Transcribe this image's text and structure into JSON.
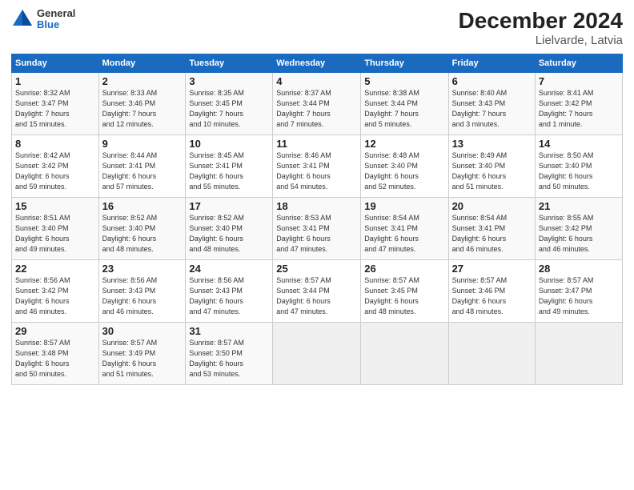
{
  "header": {
    "logo_general": "General",
    "logo_blue": "Blue",
    "title": "December 2024",
    "subtitle": "Lielvarde, Latvia"
  },
  "weekdays": [
    "Sunday",
    "Monday",
    "Tuesday",
    "Wednesday",
    "Thursday",
    "Friday",
    "Saturday"
  ],
  "weeks": [
    [
      {
        "day": "1",
        "info": "Sunrise: 8:32 AM\nSunset: 3:47 PM\nDaylight: 7 hours\nand 15 minutes."
      },
      {
        "day": "2",
        "info": "Sunrise: 8:33 AM\nSunset: 3:46 PM\nDaylight: 7 hours\nand 12 minutes."
      },
      {
        "day": "3",
        "info": "Sunrise: 8:35 AM\nSunset: 3:45 PM\nDaylight: 7 hours\nand 10 minutes."
      },
      {
        "day": "4",
        "info": "Sunrise: 8:37 AM\nSunset: 3:44 PM\nDaylight: 7 hours\nand 7 minutes."
      },
      {
        "day": "5",
        "info": "Sunrise: 8:38 AM\nSunset: 3:44 PM\nDaylight: 7 hours\nand 5 minutes."
      },
      {
        "day": "6",
        "info": "Sunrise: 8:40 AM\nSunset: 3:43 PM\nDaylight: 7 hours\nand 3 minutes."
      },
      {
        "day": "7",
        "info": "Sunrise: 8:41 AM\nSunset: 3:42 PM\nDaylight: 7 hours\nand 1 minute."
      }
    ],
    [
      {
        "day": "8",
        "info": "Sunrise: 8:42 AM\nSunset: 3:42 PM\nDaylight: 6 hours\nand 59 minutes."
      },
      {
        "day": "9",
        "info": "Sunrise: 8:44 AM\nSunset: 3:41 PM\nDaylight: 6 hours\nand 57 minutes."
      },
      {
        "day": "10",
        "info": "Sunrise: 8:45 AM\nSunset: 3:41 PM\nDaylight: 6 hours\nand 55 minutes."
      },
      {
        "day": "11",
        "info": "Sunrise: 8:46 AM\nSunset: 3:41 PM\nDaylight: 6 hours\nand 54 minutes."
      },
      {
        "day": "12",
        "info": "Sunrise: 8:48 AM\nSunset: 3:40 PM\nDaylight: 6 hours\nand 52 minutes."
      },
      {
        "day": "13",
        "info": "Sunrise: 8:49 AM\nSunset: 3:40 PM\nDaylight: 6 hours\nand 51 minutes."
      },
      {
        "day": "14",
        "info": "Sunrise: 8:50 AM\nSunset: 3:40 PM\nDaylight: 6 hours\nand 50 minutes."
      }
    ],
    [
      {
        "day": "15",
        "info": "Sunrise: 8:51 AM\nSunset: 3:40 PM\nDaylight: 6 hours\nand 49 minutes."
      },
      {
        "day": "16",
        "info": "Sunrise: 8:52 AM\nSunset: 3:40 PM\nDaylight: 6 hours\nand 48 minutes."
      },
      {
        "day": "17",
        "info": "Sunrise: 8:52 AM\nSunset: 3:40 PM\nDaylight: 6 hours\nand 48 minutes."
      },
      {
        "day": "18",
        "info": "Sunrise: 8:53 AM\nSunset: 3:41 PM\nDaylight: 6 hours\nand 47 minutes."
      },
      {
        "day": "19",
        "info": "Sunrise: 8:54 AM\nSunset: 3:41 PM\nDaylight: 6 hours\nand 47 minutes."
      },
      {
        "day": "20",
        "info": "Sunrise: 8:54 AM\nSunset: 3:41 PM\nDaylight: 6 hours\nand 46 minutes."
      },
      {
        "day": "21",
        "info": "Sunrise: 8:55 AM\nSunset: 3:42 PM\nDaylight: 6 hours\nand 46 minutes."
      }
    ],
    [
      {
        "day": "22",
        "info": "Sunrise: 8:56 AM\nSunset: 3:42 PM\nDaylight: 6 hours\nand 46 minutes."
      },
      {
        "day": "23",
        "info": "Sunrise: 8:56 AM\nSunset: 3:43 PM\nDaylight: 6 hours\nand 46 minutes."
      },
      {
        "day": "24",
        "info": "Sunrise: 8:56 AM\nSunset: 3:43 PM\nDaylight: 6 hours\nand 47 minutes."
      },
      {
        "day": "25",
        "info": "Sunrise: 8:57 AM\nSunset: 3:44 PM\nDaylight: 6 hours\nand 47 minutes."
      },
      {
        "day": "26",
        "info": "Sunrise: 8:57 AM\nSunset: 3:45 PM\nDaylight: 6 hours\nand 48 minutes."
      },
      {
        "day": "27",
        "info": "Sunrise: 8:57 AM\nSunset: 3:46 PM\nDaylight: 6 hours\nand 48 minutes."
      },
      {
        "day": "28",
        "info": "Sunrise: 8:57 AM\nSunset: 3:47 PM\nDaylight: 6 hours\nand 49 minutes."
      }
    ],
    [
      {
        "day": "29",
        "info": "Sunrise: 8:57 AM\nSunset: 3:48 PM\nDaylight: 6 hours\nand 50 minutes."
      },
      {
        "day": "30",
        "info": "Sunrise: 8:57 AM\nSunset: 3:49 PM\nDaylight: 6 hours\nand 51 minutes."
      },
      {
        "day": "31",
        "info": "Sunrise: 8:57 AM\nSunset: 3:50 PM\nDaylight: 6 hours\nand 53 minutes."
      },
      {
        "day": "",
        "info": ""
      },
      {
        "day": "",
        "info": ""
      },
      {
        "day": "",
        "info": ""
      },
      {
        "day": "",
        "info": ""
      }
    ]
  ]
}
